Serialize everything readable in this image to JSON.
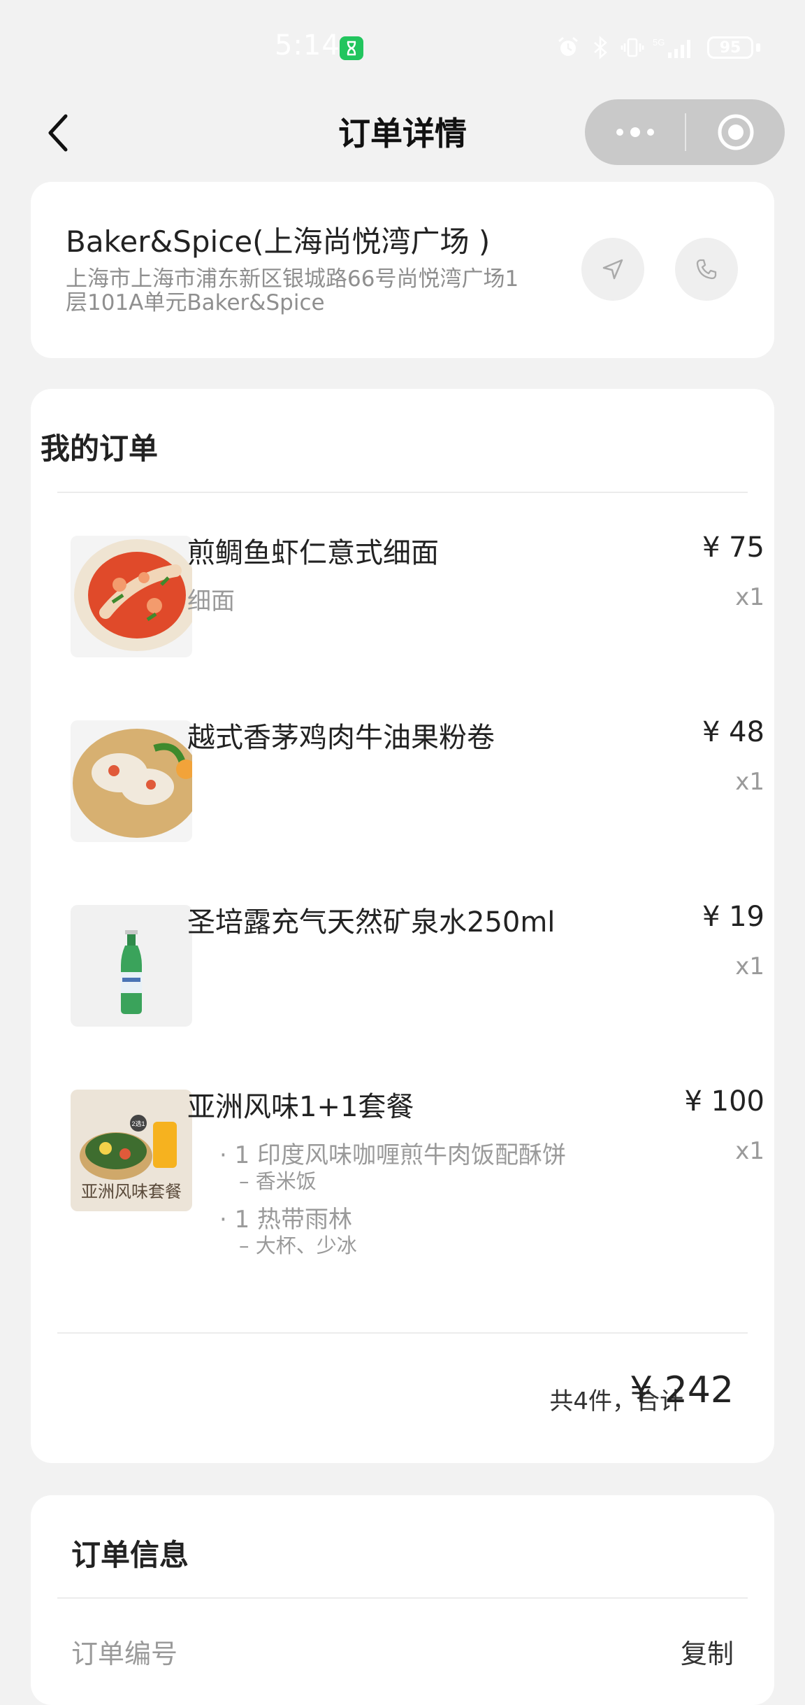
{
  "status_bar": {
    "time": "5:14",
    "battery": "95",
    "network": "5G"
  },
  "nav": {
    "title": "订单详情",
    "back_icon": "chevron-left-icon",
    "more_icon": "more-dots-icon",
    "target_icon": "target-icon"
  },
  "store": {
    "name": "Baker&Spice(上海尚悦湾广场 )",
    "address_line1": "上海市上海市浦东新区银城路66号尚悦湾广场1",
    "address_line2": "层101A单元Baker&Spice",
    "navigate_icon": "navigate-arrow-icon",
    "call_icon": "phone-icon"
  },
  "order": {
    "title": "我的订单",
    "items": [
      {
        "name": "煎鲷鱼虾仁意式细面",
        "option": "细面",
        "price": "¥ 75",
        "qty": "x1"
      },
      {
        "name": "越式香茅鸡肉牛油果粉卷",
        "price": "¥ 48",
        "qty": "x1"
      },
      {
        "name": "圣培露充气天然矿泉水250ml",
        "price": "¥ 19",
        "qty": "x1"
      },
      {
        "name": "亚洲风味1+1套餐",
        "price": "¥ 100",
        "qty": "x1",
        "image_text": "亚洲风味套餐",
        "badge": "2选1",
        "components": [
          {
            "line": "· 1 印度风味咖喱煎牛肉饭配酥饼",
            "option": "– 香米饭"
          },
          {
            "line": "· 1 热带雨林",
            "option": "– 大杯、少冰"
          }
        ]
      }
    ],
    "total_label": "共4件，合计",
    "total_value": "¥ 242"
  },
  "order_info": {
    "title": "订单信息",
    "order_no_label": "订单编号",
    "copy_label": "复制"
  },
  "colors": {
    "background": "#f2f2f2",
    "card": "#ffffff",
    "muted_text": "#9a9a9a",
    "capsule": "#c9c9c9"
  }
}
